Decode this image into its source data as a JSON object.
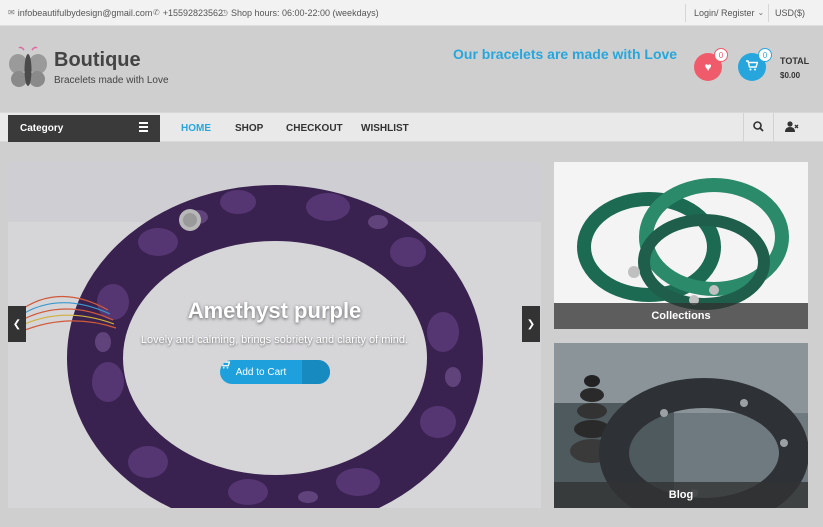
{
  "topbar": {
    "email": "infobeautifulbydesign@gmail.com",
    "phone": "+15592823562",
    "hours": "Shop hours: 06:00-22:00 (weekdays)",
    "login": "Login/ Register",
    "currency": "USD($)"
  },
  "header": {
    "brand": "Boutique",
    "tagline": "Bracelets made with Love",
    "promo": "Our bracelets are made with Love",
    "wishlist_count": "0",
    "cart_count": "0",
    "total_label": "TOTAL",
    "total_value": "$0.00"
  },
  "nav": {
    "category": "Category",
    "links": [
      "HOME",
      "SHOP",
      "CHECKOUT",
      "WISHLIST"
    ],
    "active": "HOME"
  },
  "slider": {
    "title": "Amethyst purple",
    "description": "Lovely and calming, brings sobriety and clarity of mind.",
    "button": "Add to Cart"
  },
  "cards": [
    {
      "label": "Collections"
    },
    {
      "label": "Blog"
    }
  ],
  "colors": {
    "accent": "#27a6de",
    "wishlist": "#ef5b6b",
    "dark": "#3a3a3a"
  }
}
